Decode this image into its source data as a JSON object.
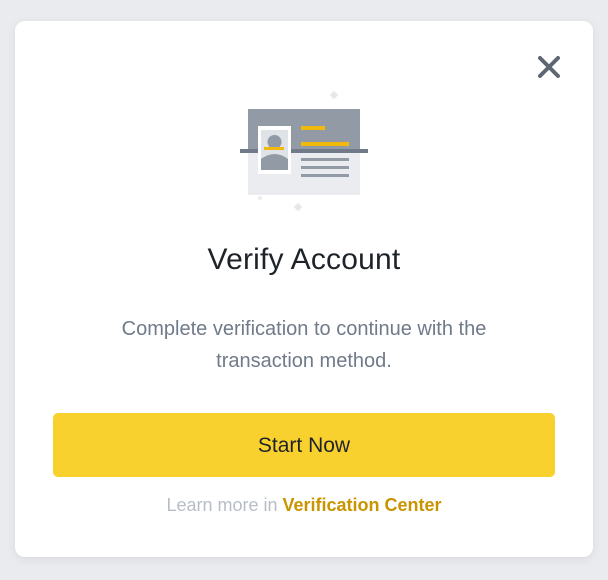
{
  "modal": {
    "title": "Verify Account",
    "description": "Complete verification to continue with the transaction method.",
    "primary_button": "Start Now",
    "footer_prefix": "Learn more in ",
    "footer_link": "Verification Center",
    "close_icon": "close-icon",
    "illustration_icon": "id-card-icon"
  },
  "colors": {
    "accent": "#FCD535",
    "link": "#C99400",
    "title": "#1E2329",
    "muted": "#707A8A"
  }
}
